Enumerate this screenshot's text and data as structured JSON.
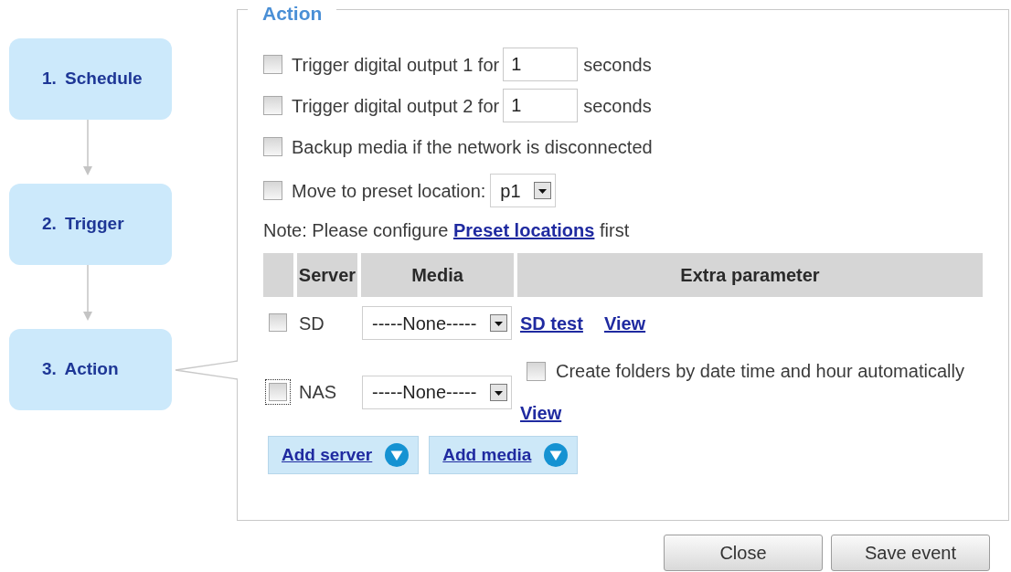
{
  "steps": [
    {
      "label": "1. Schedule",
      "selected": false
    },
    {
      "label": "2. Trigger",
      "selected": false
    },
    {
      "label": "3. Action",
      "selected": true
    }
  ],
  "panel": {
    "legend": "Action",
    "options": [
      {
        "kind": "duration",
        "checked": false,
        "label": "Trigger digital output 1 for",
        "value": "1",
        "unit": "seconds"
      },
      {
        "kind": "duration",
        "checked": false,
        "label": "Trigger digital output 2 for",
        "value": "1",
        "unit": "seconds"
      },
      {
        "kind": "plain",
        "checked": false,
        "label": "Backup media if the network is disconnected"
      },
      {
        "kind": "select",
        "checked": false,
        "label": "Move to preset location:",
        "value": "p1"
      }
    ],
    "note": {
      "text_before": "Note: Please configure",
      "link": "Preset locations",
      "text_after": "first"
    },
    "table": {
      "columns": [
        "Server",
        "Media",
        "Extra parameter"
      ],
      "rows": [
        {
          "checked": false,
          "focused": false,
          "server": "SD",
          "media": "-----None-----",
          "extra": [
            {
              "kind": "link",
              "text": "SD test"
            },
            {
              "kind": "link",
              "text": "View"
            }
          ]
        },
        {
          "checked": false,
          "focused": true,
          "server": "NAS",
          "media": "-----None-----",
          "extra": [
            {
              "kind": "checkbox",
              "checked": false,
              "label": "Create folders by date time and hour automatically"
            },
            {
              "kind": "link",
              "text": "View"
            }
          ]
        }
      ]
    },
    "add_buttons": [
      {
        "label": "Add server"
      },
      {
        "label": "Add media"
      }
    ]
  },
  "buttons": [
    "Close",
    "Save event"
  ]
}
